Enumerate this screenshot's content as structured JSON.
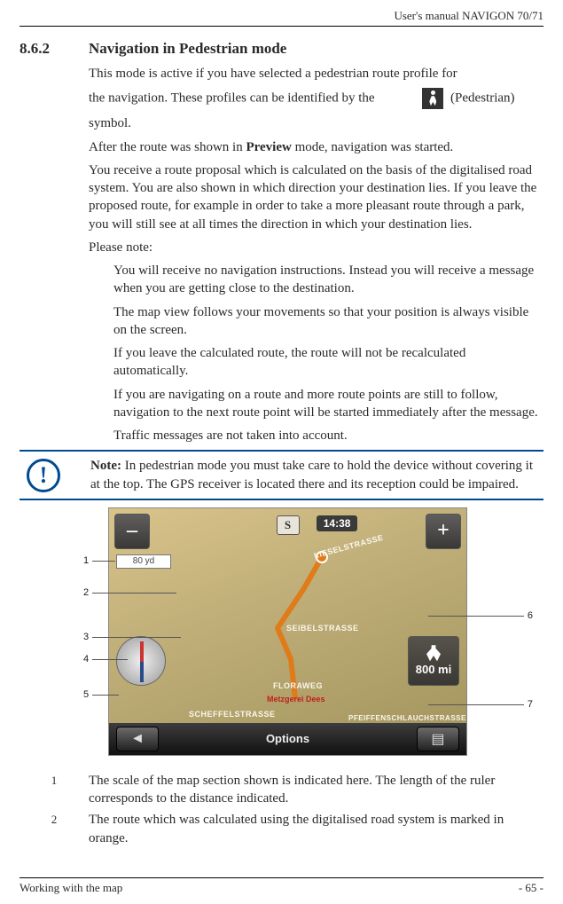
{
  "header": {
    "manual": "User's manual NAVIGON 70/71"
  },
  "section": {
    "number": "8.6.2",
    "title": "Navigation in Pedestrian mode"
  },
  "p": {
    "intro1": "This mode is active if you have selected a pedestrian route profile for",
    "intro2a": "the navigation. These profiles can be identified by the",
    "intro2b": "(Pedestrian)",
    "intro3": "symbol.",
    "preview": "After the route was shown in Preview mode, navigation was started.",
    "proposal": "You receive a route proposal which is calculated on the basis of the digitalised road system. You are also shown in which direction your destination lies. If you leave the proposed route, for example in order to take a more pleasant route through a park, you will still see at all times the direction in which your destination lies.",
    "please": "Please note:",
    "n1": "You will receive no navigation instructions. Instead you will receive a message when you are getting close to the destination.",
    "n2": "The map view follows your movements so that your position is always visible on the screen.",
    "n3": "If you leave the calculated route, the route will not be recalculated automatically.",
    "n4": "If you are navigating on a route and more route points are still to follow, navigation to the next route point will be started immediately after the message.",
    "n5": "Traffic messages are not taken into account."
  },
  "note": {
    "label": "Note:",
    "text": " In pedestrian mode you must take care to hold the device without covering it at the top. The GPS receiver is located there and its reception could be impaired."
  },
  "figure": {
    "zoom_out": "–",
    "zoom_in": "+",
    "compass": "S",
    "time": "14:38",
    "scale": "80 yd",
    "streets": {
      "s1": "LIESELSTRASSE",
      "s2": "SEIBELSTRASSE",
      "s3": "FLORAWEG",
      "s4": "SCHEFFELSTRASSE",
      "s5": "PFEIFFENSCHLAUCHSTRASSE"
    },
    "poi": "Metzgerei Dees",
    "distance": "800 mi",
    "options": "Options",
    "back": "◄",
    "layers": "▤"
  },
  "callouts": {
    "c1": "1",
    "c2": "2",
    "c3": "3",
    "c4": "4",
    "c5": "5",
    "c6": "6",
    "c7": "7"
  },
  "legend": {
    "l1n": "1",
    "l1": "The scale of the map section shown is indicated here. The length of the ruler corresponds to the distance indicated.",
    "l2n": "2",
    "l2": "The route which was calculated using the digitalised road system is marked in orange."
  },
  "footer": {
    "left": "Working with the map",
    "right": "- 65 -"
  }
}
